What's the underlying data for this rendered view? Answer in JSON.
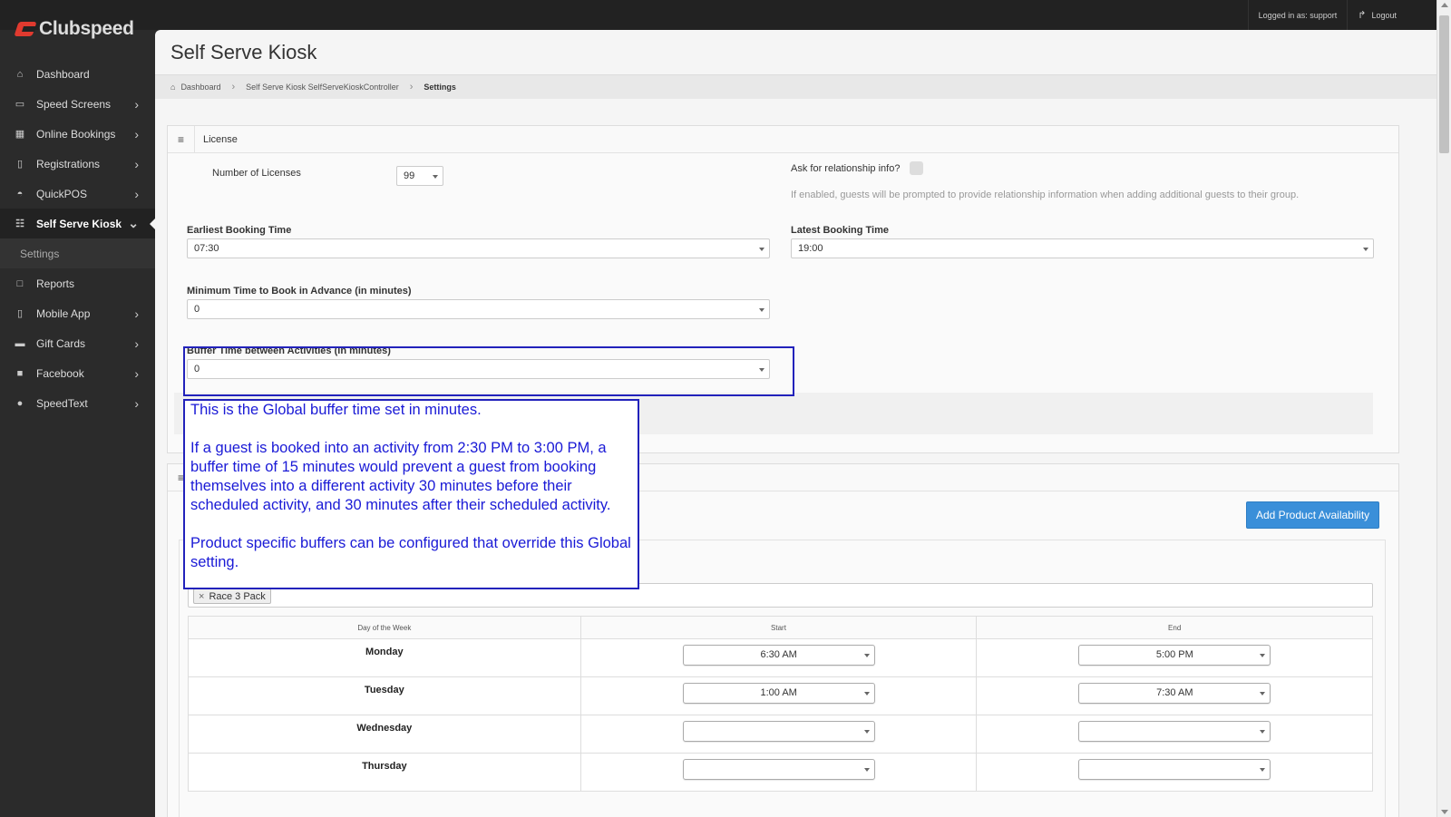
{
  "app": {
    "logo_text": "Clubspeed"
  },
  "topbar": {
    "logged_in": "Logged in as: support",
    "logout": "Logout"
  },
  "sidebar": {
    "items": [
      {
        "label": "Dashboard",
        "icon": "home-icon"
      },
      {
        "label": "Speed Screens",
        "icon": "monitor-icon"
      },
      {
        "label": "Online Bookings",
        "icon": "calendar-icon"
      },
      {
        "label": "Registrations",
        "icon": "tablet-icon"
      },
      {
        "label": "QuickPOS",
        "icon": "dashboard-icon"
      },
      {
        "label": "Self Serve Kiosk",
        "icon": "cart-icon"
      },
      {
        "label": "Settings",
        "icon": ""
      },
      {
        "label": "Reports",
        "icon": "file-icon"
      },
      {
        "label": "Mobile App",
        "icon": "mobile-icon"
      },
      {
        "label": "Gift Cards",
        "icon": "credit-card-icon"
      },
      {
        "label": "Facebook",
        "icon": "facebook-icon"
      },
      {
        "label": "SpeedText",
        "icon": "chat-icon"
      }
    ]
  },
  "page": {
    "title": "Self Serve Kiosk",
    "breadcrumb": [
      "Dashboard",
      "Self Serve Kiosk SelfServeKioskController",
      "Settings"
    ]
  },
  "license_panel": {
    "title": "License",
    "num_licenses_label": "Number of Licenses",
    "num_licenses_value": "99",
    "ask_relationship_label": "Ask for relationship info?",
    "ask_relationship_hint": "If enabled, guests will be prompted to provide relationship information when adding additional guests to their group.",
    "earliest_label": "Earliest Booking Time",
    "earliest_value": "07:30",
    "latest_label": "Latest Booking Time",
    "latest_value": "19:00",
    "min_advance_label": "Minimum Time to Book in Advance (in minutes)",
    "min_advance_value": "0",
    "buffer_label": "Buffer Time between Activities (in minutes)",
    "buffer_value": "0"
  },
  "availability_panel": {
    "add_button": "Add Product Availability",
    "products_tag": "Race 3 Pack",
    "columns": [
      "Day of the Week",
      "Start",
      "End"
    ],
    "rows": [
      {
        "day": "Monday",
        "start": "6:30 AM",
        "end": "5:00 PM"
      },
      {
        "day": "Tuesday",
        "start": "1:00 AM",
        "end": "7:30 AM"
      },
      {
        "day": "Wednesday",
        "start": "",
        "end": ""
      },
      {
        "day": "Thursday",
        "start": "",
        "end": ""
      }
    ]
  },
  "callout": {
    "para1": "This is the Global buffer time set in minutes.",
    "para2": "If a guest is booked into an activity from 2:30 PM to 3:00 PM, a buffer time of 15 minutes would prevent a guest from booking themselves into a different activity 30 minutes before their scheduled activity, and 30 minutes after their scheduled activity.",
    "para3": "Product specific buffers can be configured that override this Global setting."
  },
  "colors": {
    "brand_red": "#e03a2f",
    "annotation_blue": "#2222bb",
    "button_blue": "#3a8fd9"
  }
}
